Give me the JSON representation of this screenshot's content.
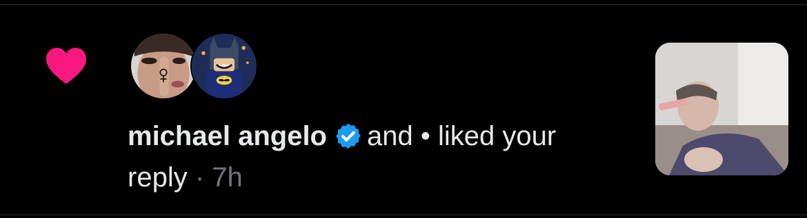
{
  "notification": {
    "type_icon": "heart-icon",
    "type_color": "#f91880",
    "actor_name": "michael angelo",
    "verified_icon": "verified-badge-icon",
    "verified_color": "#1d9bf0",
    "action_text_1": "and • liked your",
    "action_text_2": "reply",
    "separator": "·",
    "time": "7h"
  },
  "avatars": [
    {
      "name": "avatar-woman"
    },
    {
      "name": "avatar-lego-batman"
    }
  ],
  "preview": {
    "name": "reply-media-thumbnail"
  }
}
